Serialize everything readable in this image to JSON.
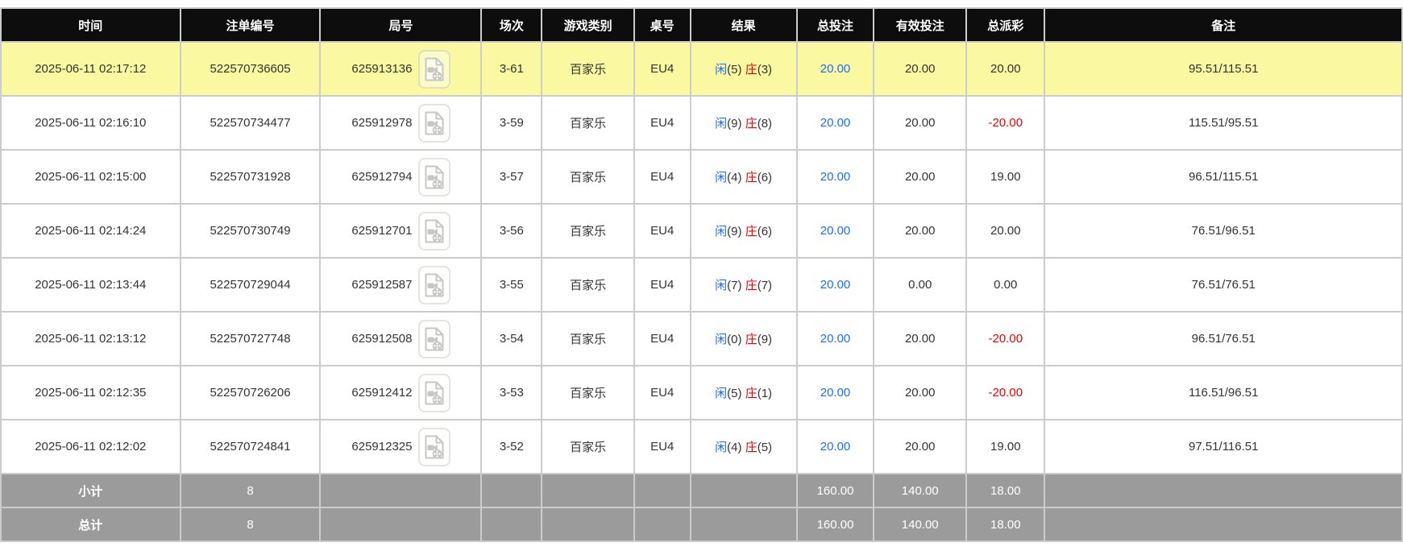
{
  "colors": {
    "header_bg": "#0d0d0d",
    "header_text": "#ffffff",
    "highlight_row_bg": "#faf8a0",
    "footer_bg": "#9b9b9b",
    "player_blue": "#1a6eff",
    "banker_red": "#f00000",
    "negative_red": "#f00000",
    "border": "#cccccc"
  },
  "table": {
    "columns": [
      "时间",
      "注单编号",
      "局号",
      "场次",
      "游戏类别",
      "桌号",
      "结果",
      "总投注",
      "有效投注",
      "总派彩",
      "备注"
    ],
    "video_icon_name": "video-replay-icon",
    "rows": [
      {
        "time": "2025-06-11 02:17:12",
        "bet_id": "522570736605",
        "round_id": "625913136",
        "session": "3-61",
        "game_type": "百家乐",
        "table_no": "EU4",
        "result_player": "闲",
        "result_player_score": "(5)",
        "result_banker": "庄",
        "result_banker_score": "(3)",
        "total_bet": "20.00",
        "valid_bet": "20.00",
        "payout": "20.00",
        "remark": "95.51/115.51",
        "highlighted": true
      },
      {
        "time": "2025-06-11 02:16:10",
        "bet_id": "522570734477",
        "round_id": "625912978",
        "session": "3-59",
        "game_type": "百家乐",
        "table_no": "EU4",
        "result_player": "闲",
        "result_player_score": "(9)",
        "result_banker": "庄",
        "result_banker_score": "(8)",
        "total_bet": "20.00",
        "valid_bet": "20.00",
        "payout": "-20.00",
        "remark": "115.51/95.51",
        "highlighted": false
      },
      {
        "time": "2025-06-11 02:15:00",
        "bet_id": "522570731928",
        "round_id": "625912794",
        "session": "3-57",
        "game_type": "百家乐",
        "table_no": "EU4",
        "result_player": "闲",
        "result_player_score": "(4)",
        "result_banker": "庄",
        "result_banker_score": "(6)",
        "total_bet": "20.00",
        "valid_bet": "20.00",
        "payout": "19.00",
        "remark": "96.51/115.51",
        "highlighted": false
      },
      {
        "time": "2025-06-11 02:14:24",
        "bet_id": "522570730749",
        "round_id": "625912701",
        "session": "3-56",
        "game_type": "百家乐",
        "table_no": "EU4",
        "result_player": "闲",
        "result_player_score": "(9)",
        "result_banker": "庄",
        "result_banker_score": "(6)",
        "total_bet": "20.00",
        "valid_bet": "20.00",
        "payout": "20.00",
        "remark": "76.51/96.51",
        "highlighted": false
      },
      {
        "time": "2025-06-11 02:13:44",
        "bet_id": "522570729044",
        "round_id": "625912587",
        "session": "3-55",
        "game_type": "百家乐",
        "table_no": "EU4",
        "result_player": "闲",
        "result_player_score": "(7)",
        "result_banker": "庄",
        "result_banker_score": "(7)",
        "total_bet": "20.00",
        "valid_bet": "0.00",
        "payout": "0.00",
        "remark": "76.51/76.51",
        "highlighted": false
      },
      {
        "time": "2025-06-11 02:13:12",
        "bet_id": "522570727748",
        "round_id": "625912508",
        "session": "3-54",
        "game_type": "百家乐",
        "table_no": "EU4",
        "result_player": "闲",
        "result_player_score": "(0)",
        "result_banker": "庄",
        "result_banker_score": "(9)",
        "total_bet": "20.00",
        "valid_bet": "20.00",
        "payout": "-20.00",
        "remark": "96.51/76.51",
        "highlighted": false
      },
      {
        "time": "2025-06-11 02:12:35",
        "bet_id": "522570726206",
        "round_id": "625912412",
        "session": "3-53",
        "game_type": "百家乐",
        "table_no": "EU4",
        "result_player": "闲",
        "result_player_score": "(5)",
        "result_banker": "庄",
        "result_banker_score": "(1)",
        "total_bet": "20.00",
        "valid_bet": "20.00",
        "payout": "-20.00",
        "remark": "116.51/96.51",
        "highlighted": false
      },
      {
        "time": "2025-06-11 02:12:02",
        "bet_id": "522570724841",
        "round_id": "625912325",
        "session": "3-52",
        "game_type": "百家乐",
        "table_no": "EU4",
        "result_player": "闲",
        "result_player_score": "(4)",
        "result_banker": "庄",
        "result_banker_score": "(5)",
        "total_bet": "20.00",
        "valid_bet": "20.00",
        "payout": "19.00",
        "remark": "97.51/116.51",
        "highlighted": false
      }
    ],
    "subtotal": {
      "label": "小计",
      "count": "8",
      "total_bet": "160.00",
      "valid_bet": "140.00",
      "payout": "18.00"
    },
    "grand_total": {
      "label": "总计",
      "count": "8",
      "total_bet": "160.00",
      "valid_bet": "140.00",
      "payout": "18.00"
    }
  }
}
